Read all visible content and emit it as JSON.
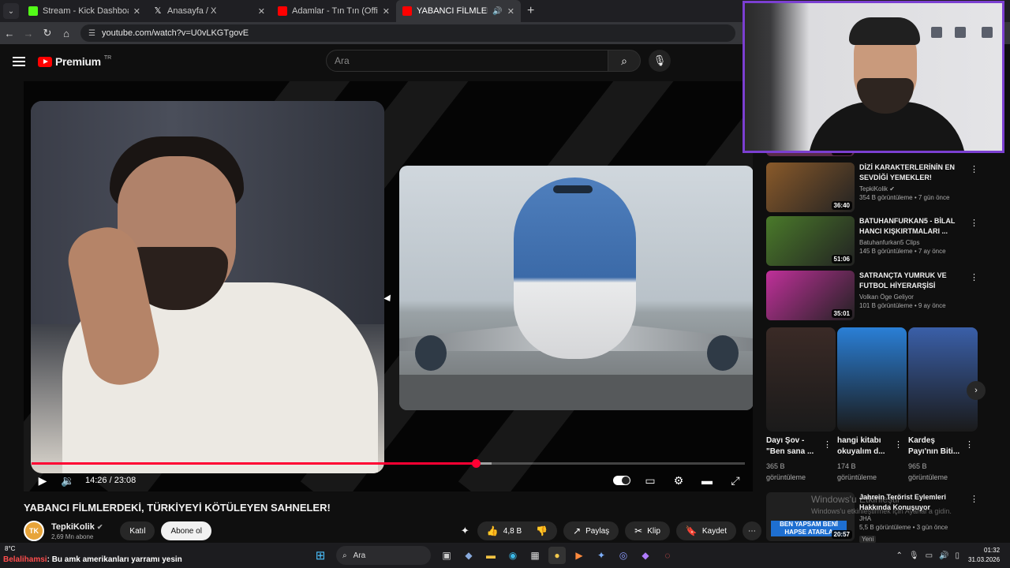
{
  "browser": {
    "tabs": [
      {
        "label": "Stream - Kick Dashboard",
        "favicon_color": "#53fc18"
      },
      {
        "label": "Anasayfa / X",
        "favicon_color": "#ffffff"
      },
      {
        "label": "Adamlar - Tın Tın (Official Audio)",
        "favicon_color": "#ff0000"
      },
      {
        "label": "YABANCI FİLMLERDEKİ, TÜR",
        "favicon_color": "#ff0000"
      }
    ],
    "url": "youtube.com/watch?v=U0vLKGTgovE"
  },
  "youtube": {
    "logo_text": "Premium",
    "logo_region": "TR",
    "search_placeholder": "Ara"
  },
  "player": {
    "time": "14:26 / 23:08",
    "progress_fraction": 0.623,
    "buffered_fraction": 0.645
  },
  "video": {
    "title": "YABANCI FİLMLERDEKİ, TÜRKİYEYİ KÖTÜLEYEN SAHNELER!",
    "channel": "TepkiKolik",
    "avatar_text": "TK",
    "subscribers": "2,69 Mn abone",
    "join_label": "Katıl",
    "subscribe_label": "Abone ol",
    "likes": "4,8 B",
    "share_label": "Paylaş",
    "clip_label": "Klip",
    "save_label": "Kaydet"
  },
  "sidebar": {
    "partial_duration": "29:22",
    "videos": [
      {
        "title": "DİZİ KARAKTERLERİNİN EN SEVDİĞİ YEMEKLER!",
        "channel": "TepkiKolik",
        "meta": "354 B görüntüleme • 7 gün önce",
        "duration": "36:40",
        "thumb_color": "#8a5a2a",
        "verified": true
      },
      {
        "title": "BATUHANFURKAN5 - BİLAL HANCI KIŞKIRTMALARI ...",
        "channel": "Batuhanfurkan5 Clips",
        "meta": "145 B görüntüleme • 7 ay önce",
        "duration": "51:06",
        "thumb_color": "#4a7a2a",
        "verified": false
      },
      {
        "title": "SATRANÇTA YUMRUK VE FUTBOL HİYERARŞİSİ",
        "channel": "Volkan Öge Geliyor",
        "meta": "101 B görüntüleme • 9 ay önce",
        "duration": "35:01",
        "thumb_color": "#c0309a",
        "verified": false
      }
    ],
    "shorts": [
      {
        "title": "Dayı Şov - \"Ben sana ...",
        "views": "365 B görüntüleme",
        "color": "#3a2a26"
      },
      {
        "title": "hangi kitabı okuyalım d...",
        "views": "174 B görüntüleme",
        "color": "#2a7fd6"
      },
      {
        "title": "Kardeş Payı'nın Biti...",
        "views": "965 B görüntüleme",
        "color": "#3a5fa8"
      }
    ],
    "last_video": {
      "title": "Jahrein Terörist Eylemleri Hakkında Konuşuyor",
      "channel": "JHA",
      "meta": "5,5 B görüntüleme • 3 gün önce",
      "badge": "Yeni",
      "duration": "20:57",
      "thumb_text": "BEN YAPSAM BENİ HAPSE ATARLA"
    }
  },
  "watermark": {
    "line1": "Windows'u Etkinleştir",
    "line2": "Windows'u etkinleştirmek için Ayarlar'a gidin."
  },
  "taskbar": {
    "weather": "8°C",
    "ticker_name": "Belalihamsi",
    "ticker_text": ": Bu amk amerikanları yarramı yesin",
    "search_label": "Ara",
    "time": "01:32",
    "date": "31.03.2026"
  }
}
